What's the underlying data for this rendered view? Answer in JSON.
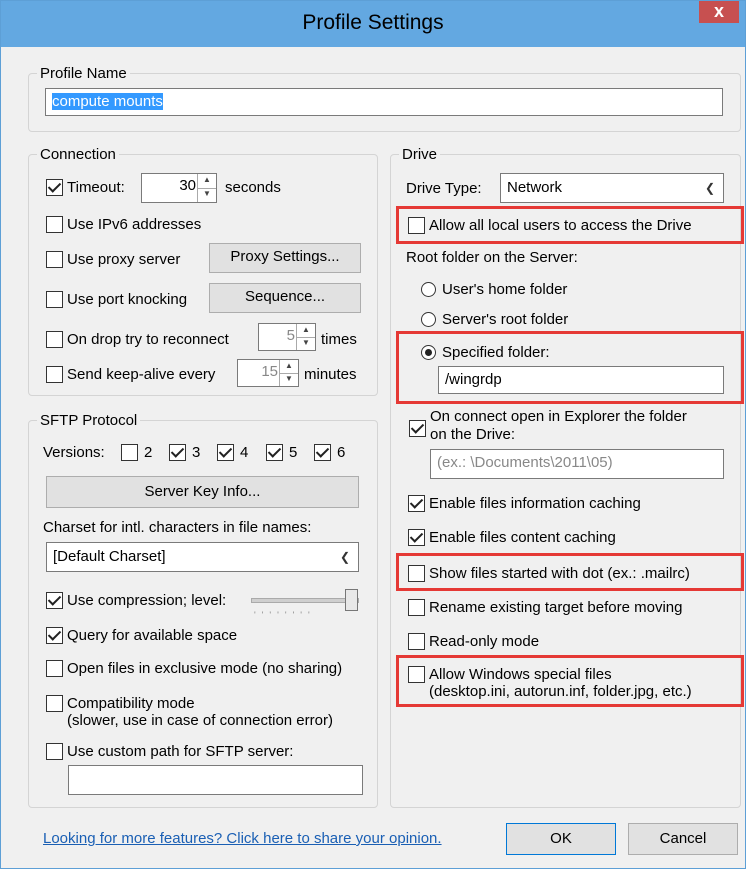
{
  "window": {
    "title": "Profile Settings",
    "close_glyph": "x"
  },
  "profile": {
    "legend": "Profile Name",
    "name_value": "compute mounts"
  },
  "connection": {
    "legend": "Connection",
    "timeout_label": "Timeout:",
    "timeout_value": "30",
    "timeout_unit": "seconds",
    "ipv6_label": "Use IPv6 addresses",
    "proxy_label": "Use proxy server",
    "proxy_button": "Proxy Settings...",
    "knock_label": "Use port knocking",
    "sequence_button": "Sequence...",
    "reconnect_label": "On drop try to reconnect",
    "reconnect_value": "5",
    "reconnect_unit": "times",
    "keepalive_label": "Send keep-alive every",
    "keepalive_value": "15",
    "keepalive_unit": "minutes"
  },
  "sftp": {
    "legend": "SFTP Protocol",
    "versions_label": "Versions:",
    "versions": [
      "2",
      "3",
      "4",
      "5",
      "6"
    ],
    "server_key_button": "Server Key Info...",
    "charset_label": "Charset for intl. characters in file names:",
    "charset_value": "[Default Charset]",
    "compression_label": "Use compression; level:",
    "query_space_label": "Query for available space",
    "exclusive_label": "Open files in exclusive mode (no sharing)",
    "compat_label_1": "Compatibility mode",
    "compat_label_2": "(slower, use in case of connection error)",
    "custom_path_label": "Use custom path for SFTP server:",
    "custom_path_value": ""
  },
  "drive": {
    "legend": "Drive",
    "type_label": "Drive Type:",
    "type_value": "Network",
    "allow_local_label": "Allow all local users to access the Drive",
    "root_label": "Root folder on the Server:",
    "home_label": "User's home folder",
    "root_folder_label": "Server's root folder",
    "specified_label": "Specified folder:",
    "specified_value": "/wingrdp",
    "open_explorer_1": "On connect open in Explorer the folder",
    "open_explorer_2": "on the Drive:",
    "explorer_placeholder": "(ex.: \\Documents\\2011\\05)",
    "info_cache_label": "Enable files information caching",
    "content_cache_label": "Enable files content caching",
    "dot_files_label": "Show files started with dot (ex.: .mailrc)",
    "rename_label": "Rename existing target before moving",
    "readonly_label": "Read-only mode",
    "special_1": "Allow Windows special files",
    "special_2": "(desktop.ini, autorun.inf, folder.jpg, etc.)"
  },
  "footer": {
    "feedback_link": "Looking for more features? Click here to share your opinion.",
    "ok_button": "OK",
    "cancel_button": "Cancel"
  },
  "colors": {
    "titlebar": "#63a8e1",
    "highlight": "#e53935",
    "link": "#1a5fb4"
  }
}
